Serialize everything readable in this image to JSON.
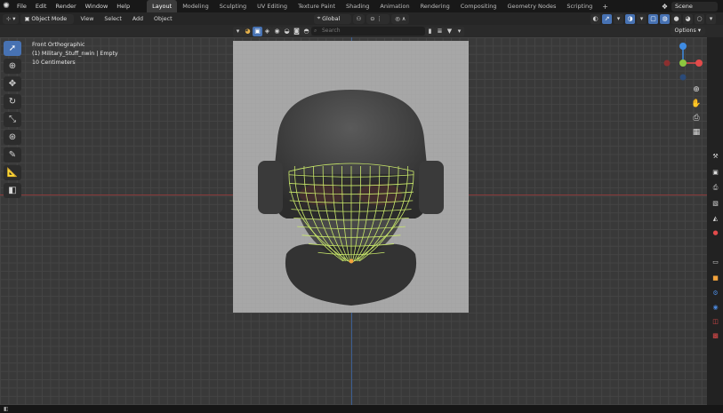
{
  "menu": [
    "File",
    "Edit",
    "Render",
    "Window",
    "Help"
  ],
  "workspaces": [
    "Layout",
    "Modeling",
    "Sculpting",
    "UV Editing",
    "Texture Paint",
    "Shading",
    "Animation",
    "Rendering",
    "Compositing",
    "Geometry Nodes",
    "Scripting"
  ],
  "active_workspace": "Layout",
  "scene": "Scene",
  "header": {
    "mode": "Object Mode",
    "menus": [
      "View",
      "Select",
      "Add",
      "Object"
    ],
    "orientation": "Global"
  },
  "search_placeholder": "Search",
  "options_label": "Options",
  "viewport_info": {
    "view": "Front Orthographic",
    "object": "(1) Military_Stuff_nwin | Empty",
    "scale": "10 Centimeters"
  },
  "gizmo": {
    "x_color": "#e34b4b",
    "y_color": "#8cc63f",
    "z_color": "#3f8ce3"
  },
  "colors": {
    "accent": "#4772b3",
    "wireframe": "#c9e86a",
    "x_axis": "#8b3a3a",
    "z_axis": "#3b5f93"
  }
}
